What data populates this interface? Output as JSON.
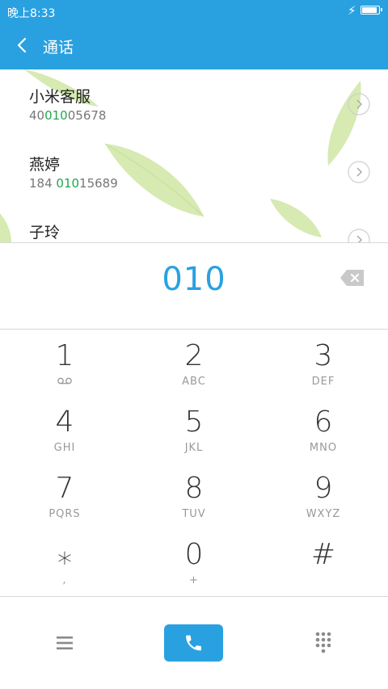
{
  "status_bar": {
    "time": "晚上8:33",
    "battery_level": 1.0
  },
  "header": {
    "title": "通话"
  },
  "contacts": [
    {
      "name": "小米客服",
      "number_pre": "40",
      "number_match": "010",
      "number_post": "05678"
    },
    {
      "name": "燕婷",
      "number_pre": "184 ",
      "number_match": "010",
      "number_post": "15689"
    },
    {
      "name": "子玲",
      "number_pre": "",
      "number_match": "",
      "number_post": ""
    }
  ],
  "dial_display": {
    "number": "010"
  },
  "keypad": [
    {
      "digit": "1",
      "letters": ""
    },
    {
      "digit": "2",
      "letters": "ABC"
    },
    {
      "digit": "3",
      "letters": "DEF"
    },
    {
      "digit": "4",
      "letters": "GHI"
    },
    {
      "digit": "5",
      "letters": "JKL"
    },
    {
      "digit": "6",
      "letters": "MNO"
    },
    {
      "digit": "7",
      "letters": "PQRS"
    },
    {
      "digit": "8",
      "letters": "TUV"
    },
    {
      "digit": "9",
      "letters": "WXYZ"
    },
    {
      "digit": "⁎",
      "letters": ","
    },
    {
      "digit": "0",
      "letters": "+"
    },
    {
      "digit": "#",
      "letters": ""
    }
  ],
  "colors": {
    "accent": "#29a1e1",
    "match": "#1ea94a",
    "leaf": "#cfe6a6"
  },
  "icons": {
    "back": "chevron-left-icon",
    "contact_detail": "chevron-right-circle-icon",
    "delete": "backspace-icon",
    "voicemail": "voicemail-icon",
    "menu": "menu-icon",
    "call": "phone-icon",
    "dialpad": "dialpad-icon"
  }
}
